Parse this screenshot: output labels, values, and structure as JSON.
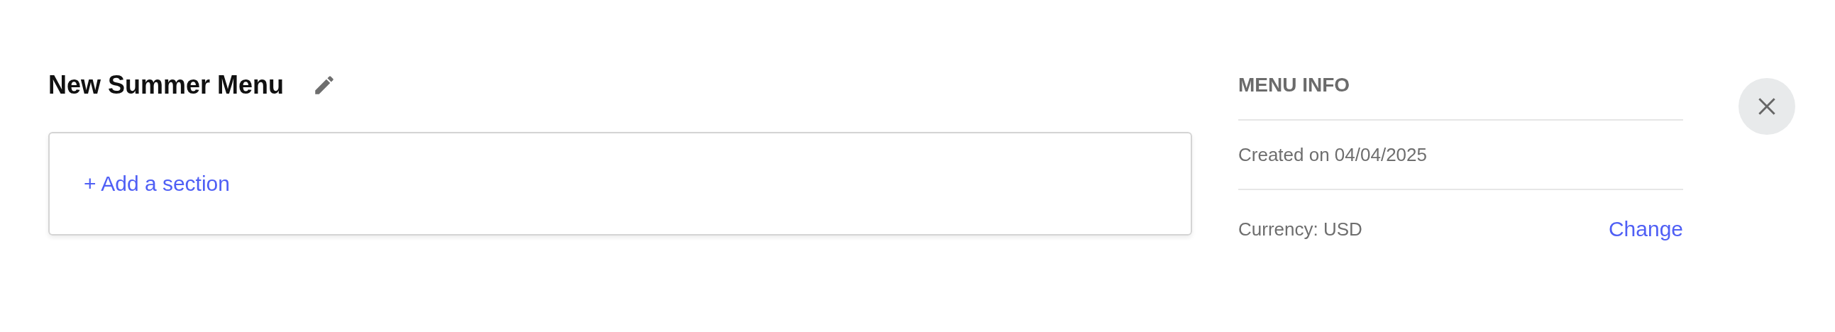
{
  "menu": {
    "title": "New Summer Menu",
    "add_section": "+ Add a section"
  },
  "info": {
    "heading": "MENU INFO",
    "created": "Created on 04/04/2025",
    "currency": "Currency: USD",
    "change_link": "Change"
  }
}
